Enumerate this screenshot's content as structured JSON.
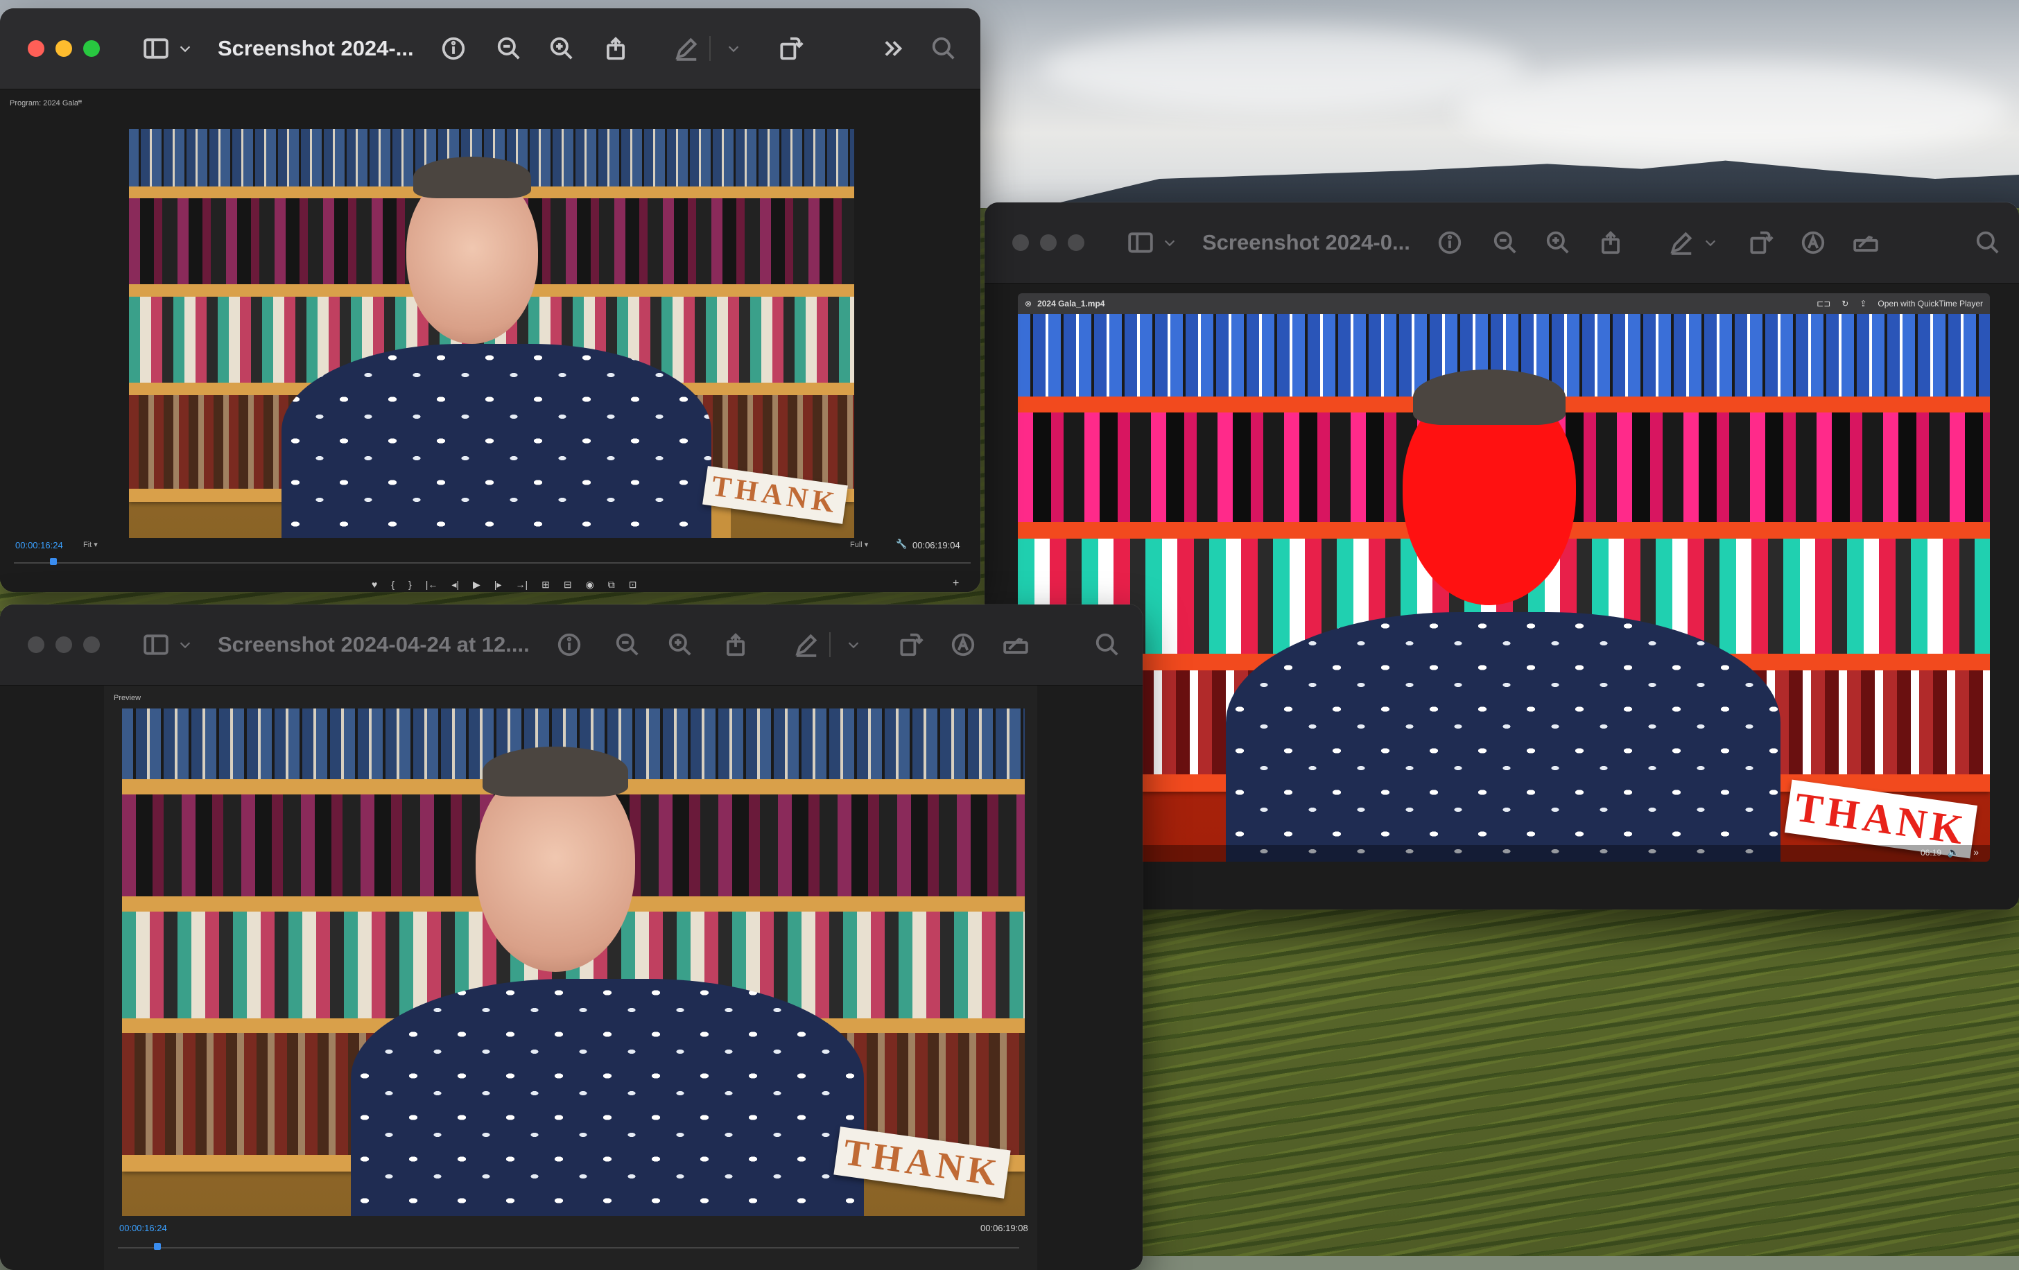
{
  "windows": {
    "top_left": {
      "title": "Screenshot 2024-...",
      "panel_label": "Program: 2024 Gala",
      "timecode_current": "00:00:16:24",
      "fit_label": "Fit",
      "quality_label": "Full",
      "timecode_total": "00:06:19:04"
    },
    "right": {
      "title": "Screenshot 2024-0...",
      "file_name": "2024 Gala_1.mp4",
      "open_with": "Open with QuickTime Player",
      "time_remaining": "06:19"
    },
    "bottom_left": {
      "title": "Screenshot 2024-04-24 at 12....",
      "panel_label": "Preview",
      "timecode_current": "00:00:16:24",
      "timecode_total": "00:06:19:08"
    }
  },
  "scene": {
    "sign_text": "THANK",
    "colors": {
      "shirt": "#1f2c52",
      "tint_red": "#ff1111",
      "timecode_blue": "#3aa0ff"
    }
  },
  "icons": [
    "sidebar-icon",
    "chevron-down-icon",
    "info-icon",
    "zoom-out-icon",
    "zoom-in-icon",
    "share-icon",
    "markup-icon",
    "rotate-icon",
    "more-icon",
    "search-icon",
    "annotate-icon",
    "signature-icon"
  ]
}
